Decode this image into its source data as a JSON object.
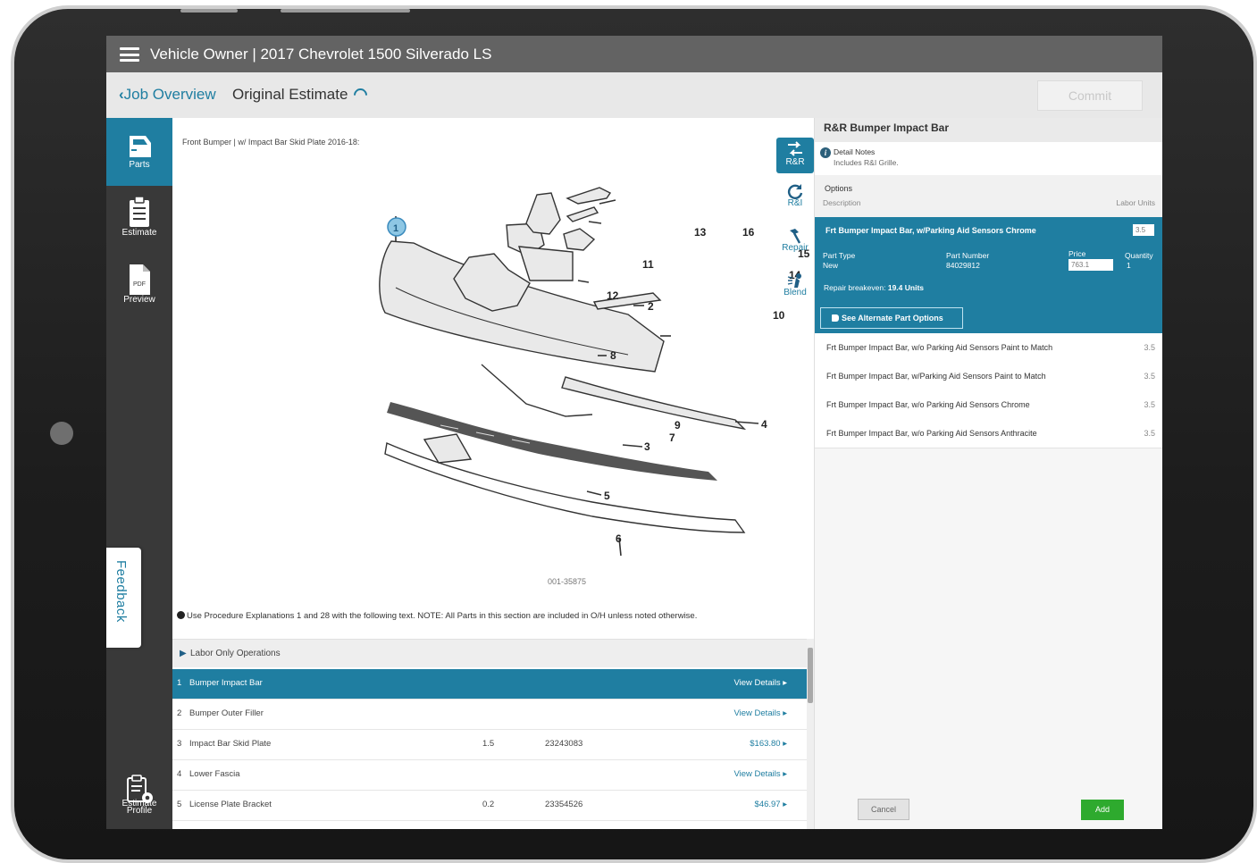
{
  "header": {
    "title": "Vehicle Owner | 2017 Chevrolet 1500 Silverado LS"
  },
  "subheader": {
    "back_label": "Job Overview",
    "estimate_title": "Original Estimate",
    "commit_label": "Commit"
  },
  "nav": {
    "items": [
      {
        "label": "Parts",
        "icon": "car-door-icon"
      },
      {
        "label": "Estimate",
        "icon": "clipboard-icon"
      },
      {
        "label": "Preview",
        "sublabel": "PDF",
        "icon": "pdf-icon"
      }
    ],
    "feedback_label": "Feedback",
    "profile_label_1": "Estimate",
    "profile_label_2": "Profile"
  },
  "diagram": {
    "title": "Front Bumper | w/ Impact Bar Skid Plate 2016-18:",
    "part_numbers": [
      "1",
      "2",
      "3",
      "4",
      "5",
      "6",
      "7",
      "8",
      "9",
      "10",
      "11",
      "12",
      "13",
      "14",
      "15",
      "16"
    ],
    "figure_code": "001-35875",
    "note": "Use Procedure Explanations 1 and 28 with the following text. NOTE: All Parts in this section are included in O/H unless noted otherwise."
  },
  "operations": [
    {
      "label": "R&R",
      "icon": "rr-arrows-icon",
      "active": true
    },
    {
      "label": "R&I",
      "icon": "refresh-icon"
    },
    {
      "label": "Repair",
      "icon": "hammer-icon"
    },
    {
      "label": "Blend",
      "icon": "spray-icon"
    }
  ],
  "parts_table": {
    "labor_only_label": "Labor Only Operations",
    "rows": [
      {
        "num": "1",
        "name": "Bumper Impact Bar",
        "units": "",
        "part_number": "",
        "action": "View Details ▸",
        "selected": true
      },
      {
        "num": "2",
        "name": "Bumper Outer Filler",
        "units": "",
        "part_number": "",
        "action": "View Details ▸"
      },
      {
        "num": "3",
        "name": "Impact Bar Skid Plate",
        "units": "1.5",
        "part_number": "23243083",
        "action": "$163.80 ▸"
      },
      {
        "num": "4",
        "name": "Lower Fascia",
        "units": "",
        "part_number": "",
        "action": "View Details ▸"
      },
      {
        "num": "5",
        "name": "License Plate Bracket",
        "units": "0.2",
        "part_number": "23354526",
        "action": "$46.97 ▸"
      }
    ]
  },
  "detail_panel": {
    "title": "R&R Bumper Impact Bar",
    "detail_notes_label": "Detail Notes",
    "detail_notes_text": "Includes R&I Grille.",
    "options_label": "Options",
    "description_header": "Description",
    "labor_units_header": "Labor Units",
    "selected_option": {
      "name": "Frt Bumper Impact Bar, w/Parking Aid Sensors Chrome",
      "labor_units": "3.5",
      "part_type_label": "Part Type",
      "part_type_value": "New",
      "part_number_label": "Part Number",
      "part_number_value": "84029812",
      "price_label": "Price",
      "price_value": "763.1",
      "quantity_label": "Quantity",
      "quantity_value": "1",
      "breakeven_label": "Repair breakeven:",
      "breakeven_value": "19.4 Units",
      "alt_parts_label": "See Alternate Part Options"
    },
    "other_options": [
      {
        "name": "Frt Bumper Impact Bar, w/o Parking Aid Sensors Paint to Match",
        "units": "3.5"
      },
      {
        "name": "Frt Bumper Impact Bar, w/Parking Aid Sensors Paint to Match",
        "units": "3.5"
      },
      {
        "name": "Frt Bumper Impact Bar, w/o Parking Aid Sensors Chrome",
        "units": "3.5"
      },
      {
        "name": "Frt Bumper Impact Bar, w/o Parking Aid Sensors Anthracite",
        "units": "3.5"
      }
    ],
    "cancel_label": "Cancel",
    "add_label": "Add"
  },
  "colors": {
    "accent": "#1f7ea1",
    "topbar": "#636363",
    "nav": "#393939",
    "add": "#2eaa2e"
  }
}
